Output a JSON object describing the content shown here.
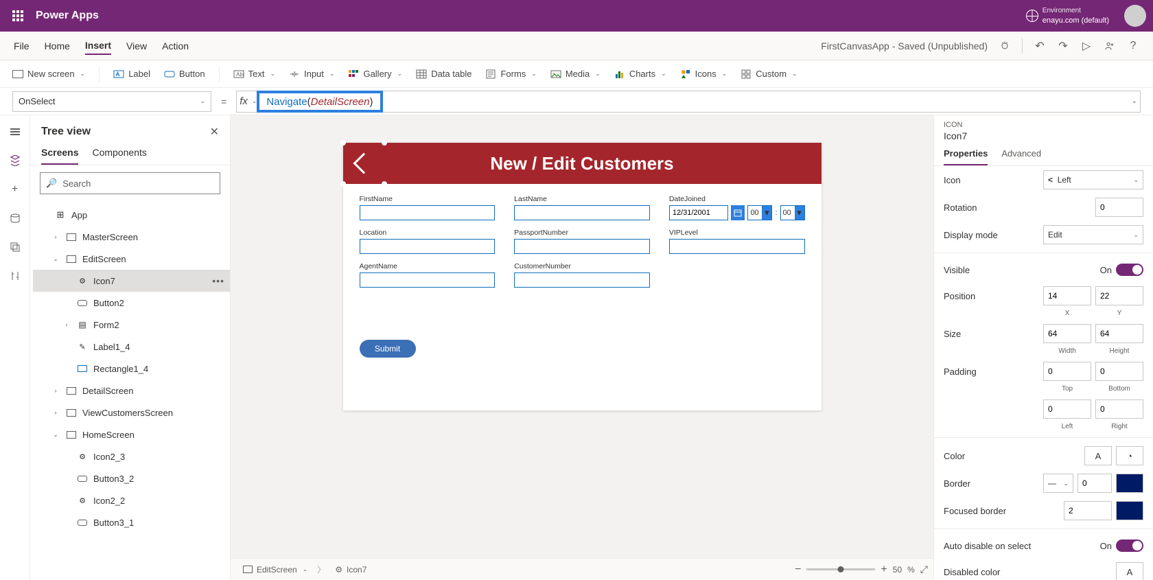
{
  "header": {
    "brand": "Power Apps",
    "env_label": "Environment",
    "env_name": "enayu.com (default)"
  },
  "menubar": {
    "items": [
      "File",
      "Home",
      "Insert",
      "View",
      "Action"
    ],
    "active": "Insert",
    "title": "FirstCanvasApp - Saved (Unpublished)"
  },
  "ribbon": {
    "new_screen": "New screen",
    "label": "Label",
    "button": "Button",
    "text": "Text",
    "input": "Input",
    "gallery": "Gallery",
    "data_table": "Data table",
    "forms": "Forms",
    "media": "Media",
    "charts": "Charts",
    "icons": "Icons",
    "custom": "Custom"
  },
  "formula": {
    "property": "OnSelect",
    "fn": "Navigate",
    "arg": "DetailScreen",
    "open": "(",
    "close": ")"
  },
  "tree": {
    "title": "Tree view",
    "tabs": [
      "Screens",
      "Components"
    ],
    "active_tab": "Screens",
    "search_ph": "Search",
    "app": "App",
    "nodes": [
      {
        "label": "MasterScreen",
        "depth": 1,
        "expand": ">",
        "type": "screen"
      },
      {
        "label": "EditScreen",
        "depth": 1,
        "expand": "v",
        "type": "screen"
      },
      {
        "label": "Icon7",
        "depth": 2,
        "type": "icon",
        "sel": true
      },
      {
        "label": "Button2",
        "depth": 2,
        "type": "button"
      },
      {
        "label": "Form2",
        "depth": 2,
        "expand": ">",
        "type": "form"
      },
      {
        "label": "Label1_4",
        "depth": 2,
        "type": "label"
      },
      {
        "label": "Rectangle1_4",
        "depth": 2,
        "type": "rect"
      },
      {
        "label": "DetailScreen",
        "depth": 1,
        "expand": ">",
        "type": "screen"
      },
      {
        "label": "ViewCustomersScreen",
        "depth": 1,
        "expand": ">",
        "type": "screen"
      },
      {
        "label": "HomeScreen",
        "depth": 1,
        "expand": "v",
        "type": "screen"
      },
      {
        "label": "Icon2_3",
        "depth": 2,
        "type": "icon"
      },
      {
        "label": "Button3_2",
        "depth": 2,
        "type": "button"
      },
      {
        "label": "Icon2_2",
        "depth": 2,
        "type": "icon"
      },
      {
        "label": "Button3_1",
        "depth": 2,
        "type": "button"
      }
    ]
  },
  "canvas": {
    "title": "New / Edit Customers",
    "fields": [
      "FirstName",
      "LastName",
      "DateJoined",
      "Location",
      "PassportNumber",
      "VIPLevel",
      "AgentName",
      "CustomerNumber"
    ],
    "date_val": "12/31/2001",
    "hh": "00",
    "mm": "00",
    "submit": "Submit"
  },
  "breadcrumb": {
    "a": "EditScreen",
    "b": "Icon7"
  },
  "zoom": {
    "pct": "50",
    "unit": "%"
  },
  "properties": {
    "category": "ICON",
    "name": "Icon7",
    "tabs": [
      "Properties",
      "Advanced"
    ],
    "active": "Properties",
    "icon_label": "Icon",
    "icon_value": "Left",
    "rotation_label": "Rotation",
    "rotation_value": "0",
    "display_label": "Display mode",
    "display_value": "Edit",
    "visible_label": "Visible",
    "visible_text": "On",
    "position_label": "Position",
    "pos_x": "14",
    "pos_y": "22",
    "x_lbl": "X",
    "y_lbl": "Y",
    "size_label": "Size",
    "w": "64",
    "h": "64",
    "w_lbl": "Width",
    "h_lbl": "Height",
    "padding_label": "Padding",
    "pt": "0",
    "pb": "0",
    "pl": "0",
    "pr": "0",
    "top_lbl": "Top",
    "bottom_lbl": "Bottom",
    "left_lbl": "Left",
    "right_lbl": "Right",
    "color_label": "Color",
    "color_letter": "A",
    "border_label": "Border",
    "border_val": "0",
    "focused_label": "Focused border",
    "focused_val": "2",
    "auto_label": "Auto disable on select",
    "auto_text": "On",
    "disabled_label": "Disabled color",
    "disabled_letter": "A"
  },
  "glyph": {
    "undo": "↶",
    "redo": "↷",
    "play": "▷",
    "person": "👤",
    "help": "?",
    "check": "✓",
    "search": "🔍",
    "plus": "+",
    "minus": "−",
    "expand": "⤢",
    "dd": "▾",
    "chev": "⌄",
    "close": "✕",
    "left_chev": "<",
    ">": ">"
  }
}
